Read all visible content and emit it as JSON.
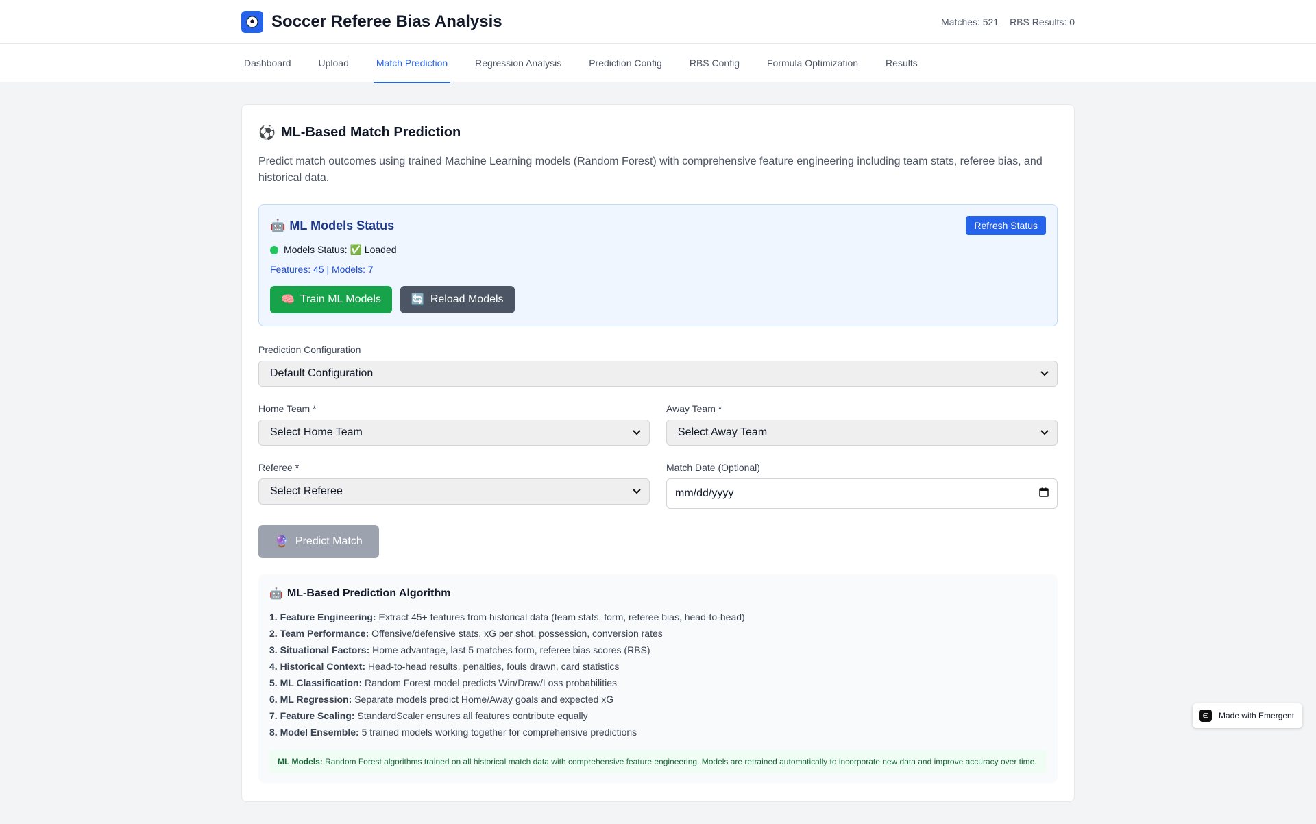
{
  "header": {
    "title": "Soccer Referee Bias Analysis",
    "matches": "Matches: 521",
    "rbs_results": "RBS Results: 0"
  },
  "nav": {
    "tabs": [
      {
        "label": "Dashboard"
      },
      {
        "label": "Upload"
      },
      {
        "label": "Match Prediction",
        "active": true
      },
      {
        "label": "Regression Analysis"
      },
      {
        "label": "Prediction Config"
      },
      {
        "label": "RBS Config"
      },
      {
        "label": "Formula Optimization"
      },
      {
        "label": "Results"
      }
    ]
  },
  "card": {
    "icon": "⚽",
    "title": "ML-Based Match Prediction",
    "description": "Predict match outcomes using trained Machine Learning models (Random Forest) with comprehensive feature engineering including team stats, referee bias, and historical data."
  },
  "status": {
    "icon": "🤖",
    "title": "ML Models Status",
    "refresh_label": "Refresh Status",
    "status_text": "Models Status: ✅ Loaded",
    "features_text": "Features: 45 | Models: 7",
    "train_icon": "🧠",
    "train_label": "Train ML Models",
    "reload_icon": "🔄",
    "reload_label": "Reload Models",
    "indicator_color": "#22c55e"
  },
  "form": {
    "config_label": "Prediction Configuration",
    "config_value": "Default Configuration",
    "home_label": "Home Team *",
    "home_value": "Select Home Team",
    "away_label": "Away Team *",
    "away_value": "Select Away Team",
    "referee_label": "Referee *",
    "referee_value": "Select Referee",
    "date_label": "Match Date (Optional)",
    "date_placeholder": "mm/dd/yyyy",
    "predict_icon": "🔮",
    "predict_label": "Predict Match"
  },
  "algorithm": {
    "icon": "🤖",
    "title": "ML-Based Prediction Algorithm",
    "steps": [
      {
        "name": "1. Feature Engineering:",
        "text": "Extract 45+ features from historical data (team stats, form, referee bias, head-to-head)"
      },
      {
        "name": "2. Team Performance:",
        "text": "Offensive/defensive stats, xG per shot, possession, conversion rates"
      },
      {
        "name": "3. Situational Factors:",
        "text": "Home advantage, last 5 matches form, referee bias scores (RBS)"
      },
      {
        "name": "4. Historical Context:",
        "text": "Head-to-head results, penalties, fouls drawn, card statistics"
      },
      {
        "name": "5. ML Classification:",
        "text": "Random Forest model predicts Win/Draw/Loss probabilities"
      },
      {
        "name": "6. ML Regression:",
        "text": "Separate models predict Home/Away goals and expected xG"
      },
      {
        "name": "7. Feature Scaling:",
        "text": "StandardScaler ensures all features contribute equally"
      },
      {
        "name": "8. Model Ensemble:",
        "text": "5 trained models working together for comprehensive predictions"
      }
    ],
    "note_label": "ML Models:",
    "note_text": "Random Forest algorithms trained on all historical match data with comprehensive feature engineering. Models are retrained automatically to incorporate new data and improve accuracy over time."
  },
  "badge": {
    "label": "Made with Emergent"
  }
}
